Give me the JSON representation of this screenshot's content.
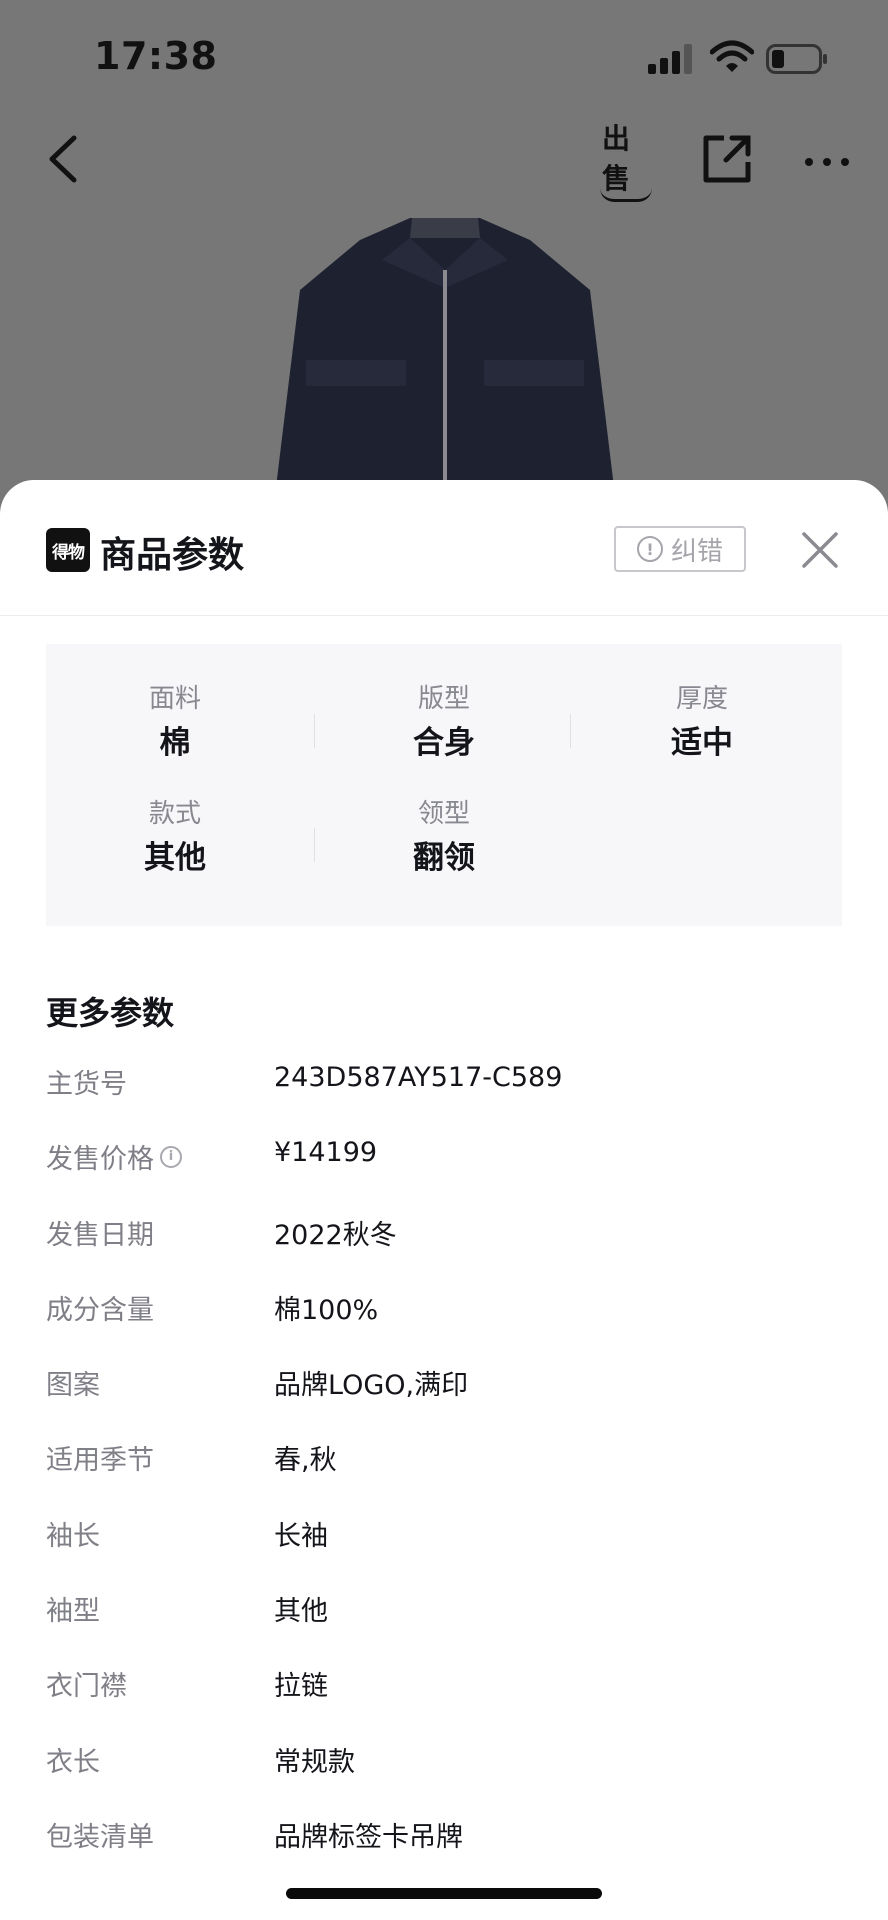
{
  "status_bar": {
    "time": "17:38"
  },
  "nav": {
    "sell_label": "出售"
  },
  "sheet": {
    "logo_text": "得物",
    "title": "商品参数",
    "correct_label": "纠错",
    "params": [
      {
        "label": "面料",
        "value": "棉"
      },
      {
        "label": "版型",
        "value": "合身"
      },
      {
        "label": "厚度",
        "value": "适中"
      },
      {
        "label": "款式",
        "value": "其他"
      },
      {
        "label": "领型",
        "value": "翻领"
      }
    ],
    "more_title": "更多参数",
    "rows": [
      {
        "label": "主货号",
        "value": "243D587AY517-C589"
      },
      {
        "label": "发售价格",
        "value": "¥14199",
        "info": true
      },
      {
        "label": "发售日期",
        "value": "2022秋冬"
      },
      {
        "label": "成分含量",
        "value": "棉100%"
      },
      {
        "label": "图案",
        "value": "品牌LOGO,满印"
      },
      {
        "label": "适用季节",
        "value": "春,秋"
      },
      {
        "label": "袖长",
        "value": "长袖"
      },
      {
        "label": "袖型",
        "value": "其他"
      },
      {
        "label": "衣门襟",
        "value": "拉链"
      },
      {
        "label": "衣长",
        "value": "常规款"
      },
      {
        "label": "包装清单",
        "value": "品牌标签卡吊牌"
      }
    ]
  },
  "icons": {
    "back": "chevron-left-icon",
    "share": "share-icon",
    "more": "more-dots-icon",
    "close": "close-icon"
  }
}
